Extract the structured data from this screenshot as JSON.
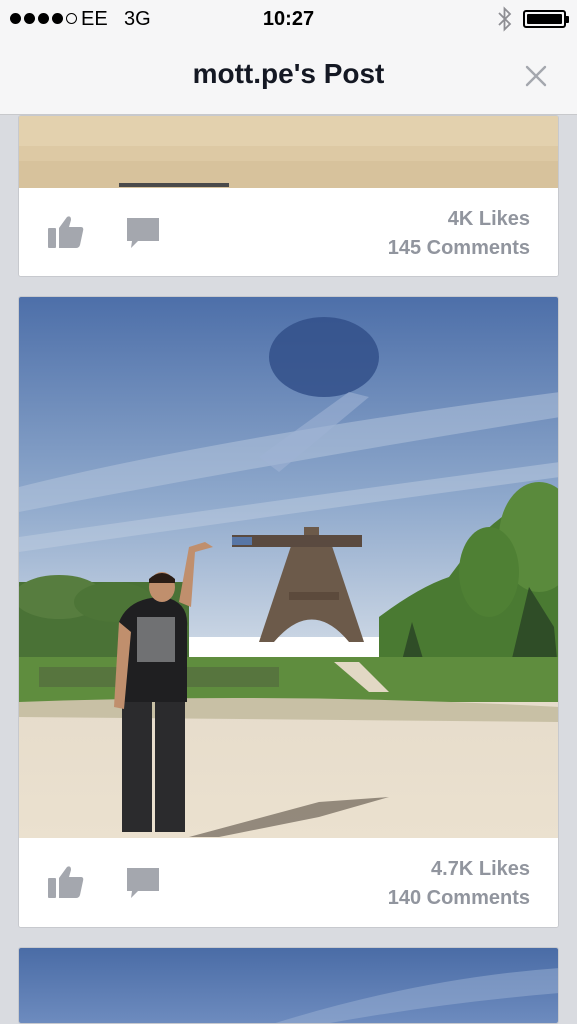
{
  "status": {
    "carrier": "EE",
    "network": "3G",
    "time": "10:27",
    "signal_bars": 4,
    "signal_max": 5,
    "bluetooth_icon": "bluetooth-icon",
    "battery_level": 1.0
  },
  "nav": {
    "title": "mott.pe's Post",
    "close_icon": "close-icon"
  },
  "posts": [
    {
      "likes": "4K Likes",
      "comments": "145 Comments"
    },
    {
      "likes": "4.7K Likes",
      "comments": "140 Comments"
    }
  ],
  "colors": {
    "meta_text": "#91959e",
    "icon_gray": "#a4a7ae",
    "background": "#d9dbe0"
  }
}
